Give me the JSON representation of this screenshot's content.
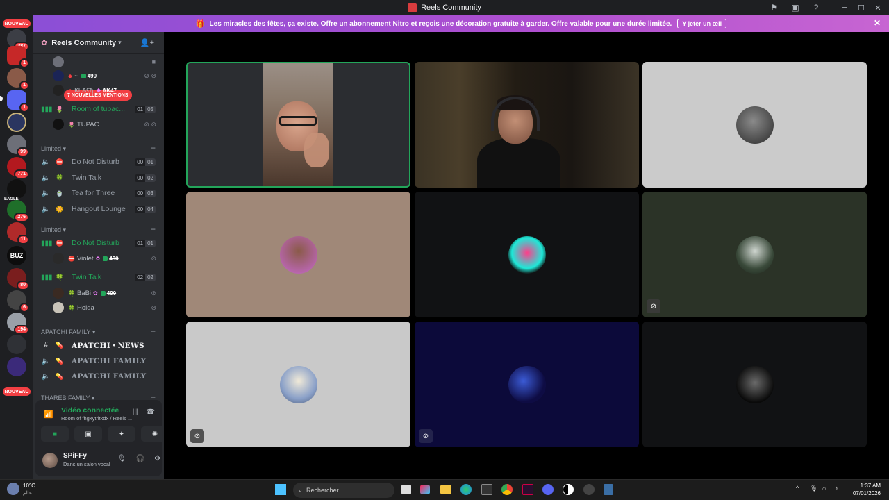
{
  "window": {
    "title": "Reels Community"
  },
  "banner": {
    "text": "Les miracles des fêtes, ça existe. Offre un abonnement Nitro et reçois une décoration gratuite à garder. Offre valable pour une durée limitée.",
    "cta": "Y jeter un œil"
  },
  "rail": {
    "badges": [
      "107",
      "387",
      "1",
      "1",
      "1",
      "99",
      "771",
      "276",
      "11",
      "80",
      "6",
      "194"
    ],
    "new_label": "NOUVEAU",
    "logo_texts": [
      "BUZ",
      "EAGLE"
    ]
  },
  "server": {
    "name": "Reels Community"
  },
  "mentions": {
    "label": "7 NOUVELLES MENTIONS"
  },
  "top_users": [
    {
      "name": "~",
      "tag": "490"
    },
    {
      "name": "ҜĿAʕђ",
      "tag": "AK47"
    }
  ],
  "room_tupac": {
    "label": "Room of tupac...",
    "count_a": "01",
    "count_b": "05",
    "user": "TUPAC"
  },
  "categories": {
    "limited_1": "Limited",
    "limited_2": "Limited",
    "apatchi": "APATCHI FAMILY",
    "thareb": "THAREB FAMILY"
  },
  "limited_channels": [
    {
      "label": "Do Not Disturb",
      "a": "00",
      "b": "01"
    },
    {
      "label": "Twin Talk",
      "a": "00",
      "b": "02"
    },
    {
      "label": "Tea for Three",
      "a": "00",
      "b": "03"
    },
    {
      "label": "Hangout Lounge",
      "a": "00",
      "b": "04"
    }
  ],
  "active_dnd": {
    "label": "Do Not Disturb",
    "a": "01",
    "b": "01",
    "user": "Violet",
    "tag": "490"
  },
  "active_twin": {
    "label": "Twin Talk",
    "a": "02",
    "b": "02",
    "user1": "BaBi",
    "tag1": "490",
    "user2": "Holda"
  },
  "apatchi_channels": [
    {
      "label": "APATCHI・NEWS"
    },
    {
      "label": "APATCHI FAMILY"
    },
    {
      "label": "APATCHI FAMILY"
    }
  ],
  "voice": {
    "status": "Vidéo connectée",
    "room": "Room of fhgxytrltkdx / Reels ..."
  },
  "user_panel": {
    "name": "SPiFFy",
    "status": "Dans un salon vocal"
  },
  "taskbar": {
    "weather_temp": "10°C",
    "weather_loc": "عالم",
    "search_placeholder": "Rechercher",
    "time": "1:37 AM",
    "date": "07/01/2026"
  },
  "colors": {
    "accent_green": "#23a55a",
    "badge_red": "#f23f43",
    "banner_purple": "#a34fd3"
  }
}
